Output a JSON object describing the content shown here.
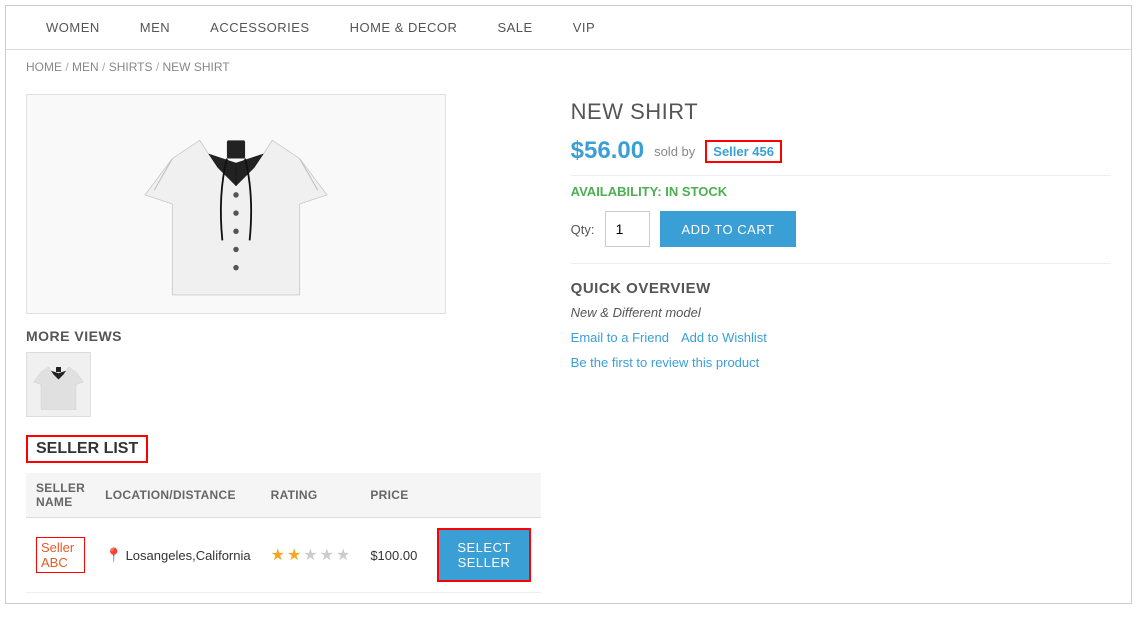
{
  "nav": {
    "items": [
      "WOMEN",
      "MEN",
      "ACCESSORIES",
      "HOME & DECOR",
      "SALE",
      "VIP"
    ]
  },
  "breadcrumb": {
    "parts": [
      "HOME",
      "MEN",
      "SHIRTS",
      "NEW SHIRT"
    ]
  },
  "product": {
    "title": "NEW SHIRT",
    "price": "$56.00",
    "sold_by_label": "sold by",
    "seller_badge": "Seller 456",
    "availability_label": "AVAILABILITY:",
    "availability_status": "IN STOCK",
    "qty_label": "Qty:",
    "qty_value": "1",
    "add_to_cart_label": "ADD TO CART",
    "quick_overview_title": "QUICK OVERVIEW",
    "description": "New & Different model",
    "email_to_friend": "Email to a Friend",
    "add_to_wishlist": "Add to Wishlist",
    "review_link": "Be the first to review this product"
  },
  "more_views_label": "MORE VIEWS",
  "seller_list": {
    "title": "SELLER LIST",
    "columns": {
      "seller_name": "SELLER NAME",
      "location_distance": "LOCATION/DISTANCE",
      "rating": "RATING",
      "price": "PRICE"
    },
    "rows": [
      {
        "name": "Seller ABC",
        "location": "Losangeles,California",
        "rating": 2,
        "max_rating": 5,
        "price": "$100.00",
        "select_label": "SELECT SELLER"
      }
    ]
  }
}
